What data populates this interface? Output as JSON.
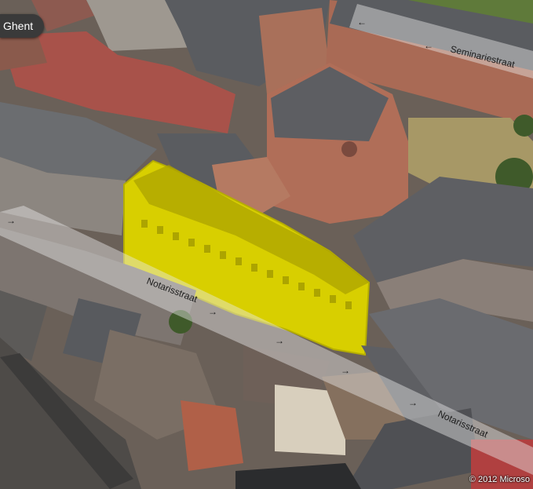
{
  "map": {
    "city_label": "Ghent",
    "copyright": "© 2012 Microso",
    "streets": [
      {
        "id": "seminariestraat",
        "name": "Seminariestraat"
      },
      {
        "id": "notarisstraat-west",
        "name": "Notarisstraat"
      },
      {
        "id": "notarisstraat-east",
        "name": "Notarisstraat"
      }
    ],
    "highlight_color": "#d8cf00",
    "colors": {
      "roof_red": "#a8524a",
      "roof_grey": "#5a5c60",
      "brick": "#a96a55",
      "lawn": "#a79866",
      "tree": "#3f5a2a",
      "street_band": "#e8e8e8"
    }
  }
}
